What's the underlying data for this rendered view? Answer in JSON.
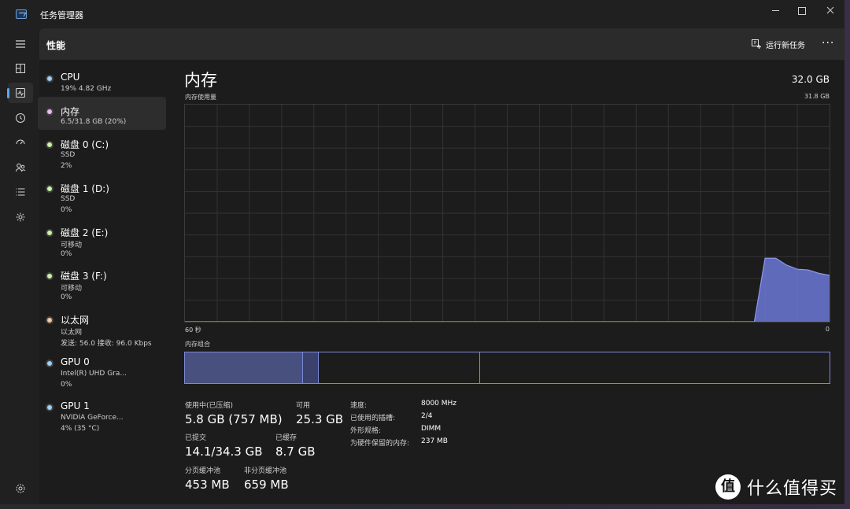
{
  "window": {
    "title": "任务管理器"
  },
  "header": {
    "title": "性能",
    "run_task": "运行新任务",
    "more": "···"
  },
  "rail": [
    "menu-icon",
    "processes-icon",
    "performance-icon",
    "history-icon",
    "startup-icon",
    "users-icon",
    "details-icon",
    "services-icon",
    "settings-icon"
  ],
  "devices": [
    {
      "name": "CPU",
      "line1": "19%  4.82 GHz",
      "line2": "",
      "color": "#9cd0ff"
    },
    {
      "name": "内存",
      "line1": "6.5/31.8 GB (20%)",
      "line2": "",
      "color": "#f2b8f5"
    },
    {
      "name": "磁盘 0 (C:)",
      "line1": "SSD",
      "line2": "2%",
      "color": "#c9f5a5"
    },
    {
      "name": "磁盘 1 (D:)",
      "line1": "SSD",
      "line2": "0%",
      "color": "#c9f5a5"
    },
    {
      "name": "磁盘 2 (E:)",
      "line1": "可移动",
      "line2": "0%",
      "color": "#c9f5a5"
    },
    {
      "name": "磁盘 3 (F:)",
      "line1": "可移动",
      "line2": "0%",
      "color": "#c9f5a5"
    },
    {
      "name": "以太网",
      "line1": "以太网",
      "line2": "发送: 56.0  接收: 96.0 Kbps",
      "color": "#f6c89e"
    },
    {
      "name": "GPU 0",
      "line1": "Intel(R) UHD Gra...",
      "line2": "0%",
      "color": "#9cd0ff"
    },
    {
      "name": "GPU 1",
      "line1": "NVIDIA GeForce...",
      "line2": "4% (35 °C)",
      "color": "#9cd0ff"
    }
  ],
  "memory": {
    "title": "内存",
    "total": "32.0 GB",
    "usage_label": "内存使用量",
    "usage_max": "31.8 GB",
    "axis_left": "60 秒",
    "axis_right": "0",
    "composition_label": "内存组合",
    "composition_fractions": [
      0.183,
      0.024,
      0.251,
      0.542
    ],
    "stats": {
      "in_use_label": "使用中(已压缩)",
      "in_use": "5.8 GB (757 MB)",
      "available_label": "可用",
      "available": "25.3 GB",
      "committed_label": "已提交",
      "committed": "14.1/34.3 GB",
      "cached_label": "已缓存",
      "cached": "8.7 GB",
      "paged_label": "分页缓冲池",
      "paged": "453 MB",
      "nonpaged_label": "非分页缓冲池",
      "nonpaged": "659 MB"
    },
    "specs": {
      "speed_label": "速度:",
      "speed": "8000 MHz",
      "slots_label": "已使用的插槽:",
      "slots": "2/4",
      "form_label": "外形规格:",
      "form": "DIMM",
      "reserved_label": "为硬件保留的内存:",
      "reserved": "237 MB"
    }
  },
  "chart_data": {
    "type": "area",
    "x": [
      60,
      7,
      6,
      5,
      4,
      3,
      2,
      1,
      0
    ],
    "values": [
      0,
      0,
      9.3,
      9.3,
      8.3,
      7.7,
      7.6,
      7.1,
      6.8
    ],
    "ylim": [
      0,
      31.8
    ],
    "xlim": [
      60,
      0
    ],
    "grid": true,
    "color": "#6b78d6"
  },
  "watermark": {
    "logo": "值",
    "text": "什么值得买"
  }
}
